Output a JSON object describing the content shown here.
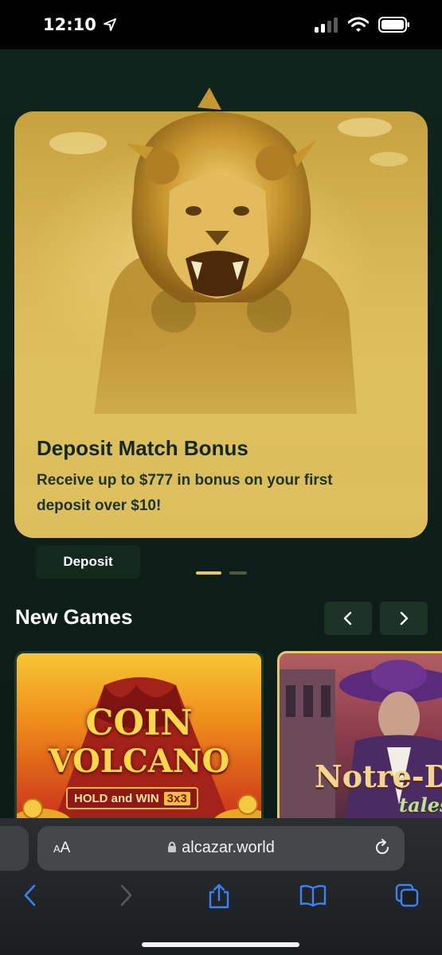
{
  "status_bar": {
    "time": "12:10"
  },
  "promo": {
    "title": "Deposit Match Bonus",
    "description": "Receive up to $777 in bonus on your first deposit over $10!",
    "button_label": "Deposit"
  },
  "carousel": {
    "slides": 2,
    "active_index": 0
  },
  "new_games": {
    "title": "New Games",
    "prev_icon": "chevron-left-icon",
    "next_icon": "chevron-right-icon",
    "games": [
      {
        "line1": "COIN",
        "line2": "VOLCANO",
        "badge": "HOLD and WIN",
        "badge_extra": "3x3"
      },
      {
        "line1": "Notre-D",
        "line2": "tales"
      }
    ]
  },
  "browser": {
    "text_size_label_small": "A",
    "text_size_label_large": "A",
    "url": "alcazar.world"
  },
  "colors": {
    "background": "#0e1f19",
    "accent_gold": "#e6c46a",
    "button_dark": "#13291f"
  }
}
